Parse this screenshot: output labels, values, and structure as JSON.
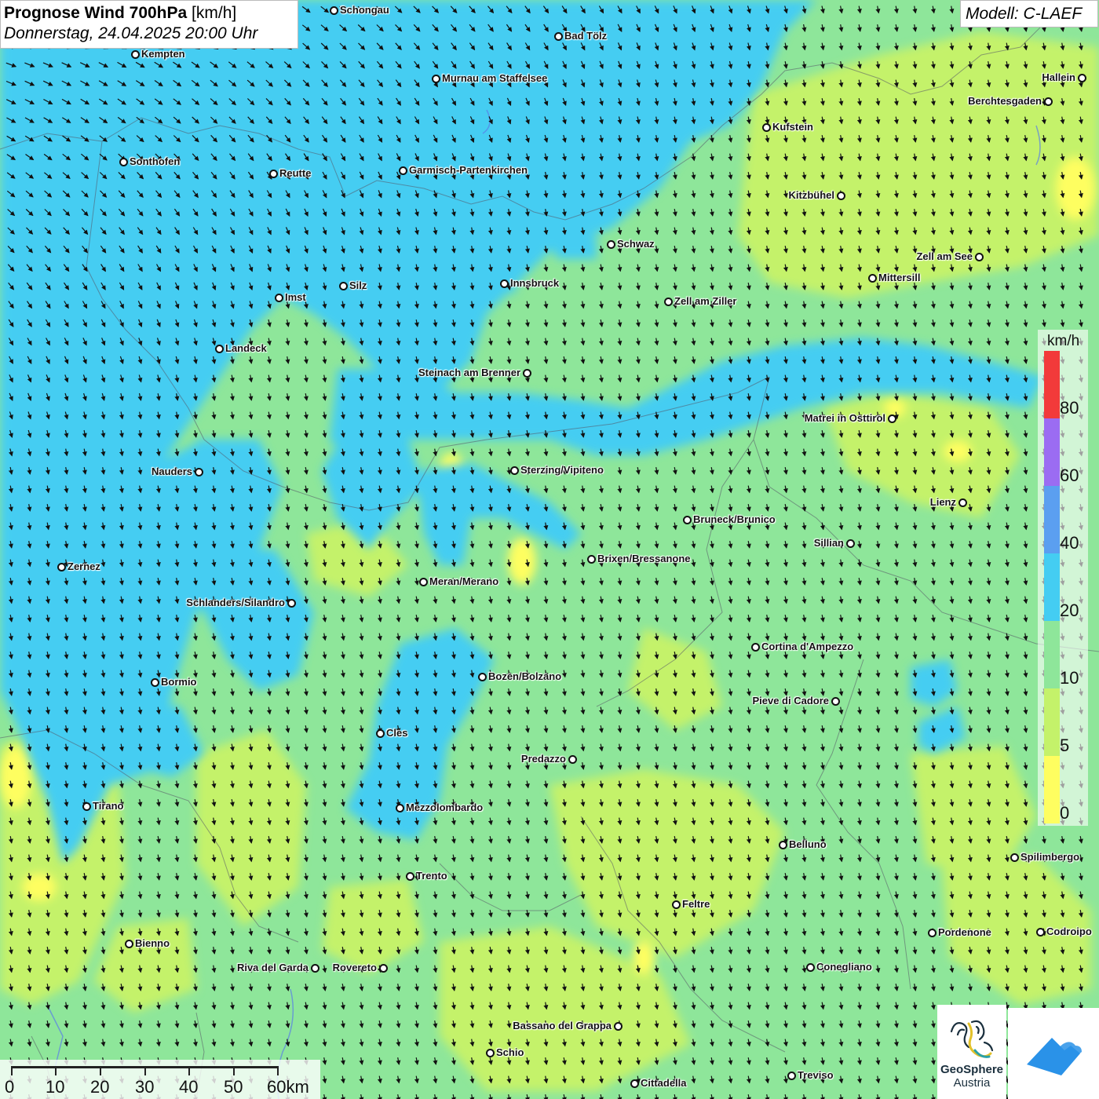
{
  "header": {
    "title_bold": "Prognose Wind 700hPa",
    "title_unit": "[km/h]",
    "subtitle": "Donnerstag, 24.04.2025 20:00 Uhr"
  },
  "model_label": "Modell: C-LAEF",
  "colors": {
    "band_0_5": "#fefe60",
    "band_5_10": "#c4f26a",
    "band_10_20": "#8ee69a",
    "band_20_40": "#44cdf2",
    "band_40_60": "#5b9ff0",
    "band_60_80": "#9b6cf2",
    "band_80_plus": "#f23a3a",
    "arrow": "#111111"
  },
  "legend": {
    "unit": "km/h",
    "labels": [
      "80",
      "60",
      "40",
      "20",
      "10",
      "5",
      "0"
    ]
  },
  "scale": {
    "labels": [
      "0",
      "10",
      "20",
      "30",
      "40",
      "50",
      "60km"
    ]
  },
  "cities": [
    {
      "name": "Schongau"
    },
    {
      "name": "Bad Tölz"
    },
    {
      "name": "Kempten"
    },
    {
      "name": "Murnau am Staffelsee"
    },
    {
      "name": "Hallein"
    },
    {
      "name": "Berchtesgaden"
    },
    {
      "name": "Kufstein"
    },
    {
      "name": "Sonthofen"
    },
    {
      "name": "Reutte"
    },
    {
      "name": "Garmisch-Partenkirchen"
    },
    {
      "name": "Kitzbühel"
    },
    {
      "name": "Schwaz"
    },
    {
      "name": "Zell am See"
    },
    {
      "name": "Innsbruck"
    },
    {
      "name": "Mittersill"
    },
    {
      "name": "Silz"
    },
    {
      "name": "Imst"
    },
    {
      "name": "Zell am Ziller"
    },
    {
      "name": "Landeck"
    },
    {
      "name": "Steinach am Brenner"
    },
    {
      "name": "Matrei in Osttirol"
    },
    {
      "name": "Nauders"
    },
    {
      "name": "Sterzing/Vipiteno"
    },
    {
      "name": "Lienz"
    },
    {
      "name": "Bruneck/Brunico"
    },
    {
      "name": "Sillian"
    },
    {
      "name": "Zernez"
    },
    {
      "name": "Brixen/Bressanone"
    },
    {
      "name": "Meran/Merano"
    },
    {
      "name": "Schlanders/Silandro"
    },
    {
      "name": "Cortina d'Ampezzo"
    },
    {
      "name": "Bozen/Bolzano"
    },
    {
      "name": "Bormio"
    },
    {
      "name": "Pieve di Cadore"
    },
    {
      "name": "Cles"
    },
    {
      "name": "Predazzo"
    },
    {
      "name": "Tirano"
    },
    {
      "name": "Mezzolombardo"
    },
    {
      "name": "Belluno"
    },
    {
      "name": "Spilimbergo"
    },
    {
      "name": "Trento"
    },
    {
      "name": "Feltre"
    },
    {
      "name": "Pordenone"
    },
    {
      "name": "Codroipo"
    },
    {
      "name": "Bienno"
    },
    {
      "name": "Riva del Garda"
    },
    {
      "name": "Rovereto"
    },
    {
      "name": "Conegliano"
    },
    {
      "name": "Bassano del Grappa"
    },
    {
      "name": "Schio"
    },
    {
      "name": "Treviso"
    },
    {
      "name": "Cittadella"
    }
  ],
  "logos": {
    "geosphere_line1": "GeoSphere",
    "geosphere_line2": "Austria"
  }
}
